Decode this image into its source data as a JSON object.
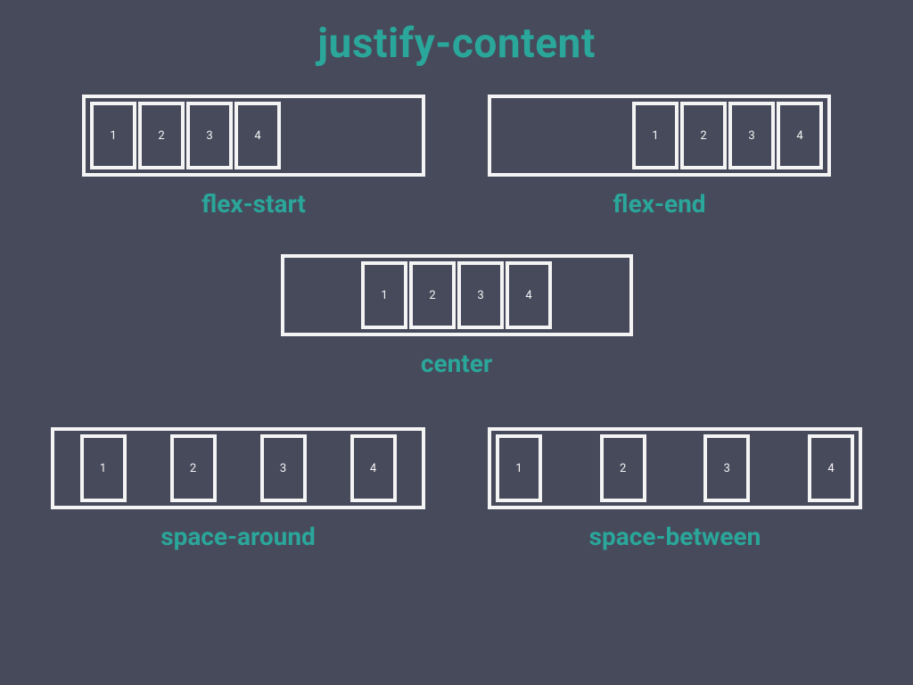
{
  "title": "justify-content",
  "items": [
    "1",
    "2",
    "3",
    "4"
  ],
  "examples": {
    "flex_start": {
      "label": "flex-start",
      "css": "jc-flex-start",
      "box": "w-large"
    },
    "flex_end": {
      "label": "flex-end",
      "css": "jc-flex-end",
      "box": "w-large"
    },
    "center": {
      "label": "center",
      "css": "jc-center",
      "box": "w-small"
    },
    "space_around": {
      "label": "space-around",
      "css": "jc-space-around",
      "box": "w-medium"
    },
    "space_between": {
      "label": "space-between",
      "css": "jc-space-between",
      "box": "w-medium"
    }
  },
  "colors": {
    "bg": "#474a5b",
    "accent": "#2aa69a",
    "line": "#f4f4f4"
  }
}
